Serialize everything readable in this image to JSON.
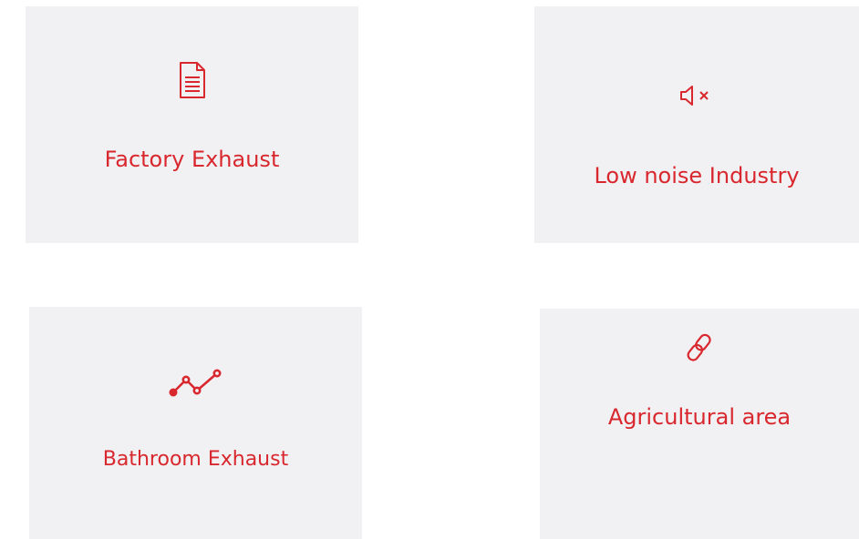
{
  "accent_color": "#d9272e",
  "card_background": "#f1f1f3",
  "cards": [
    {
      "label": "Factory Exhaust",
      "icon": "document-icon"
    },
    {
      "label": "Low noise Industry",
      "icon": "volume-mute-icon"
    },
    {
      "label": "Bathroom Exhaust",
      "icon": "line-chart-icon"
    },
    {
      "label": "Agricultural area",
      "icon": "link-icon"
    }
  ]
}
